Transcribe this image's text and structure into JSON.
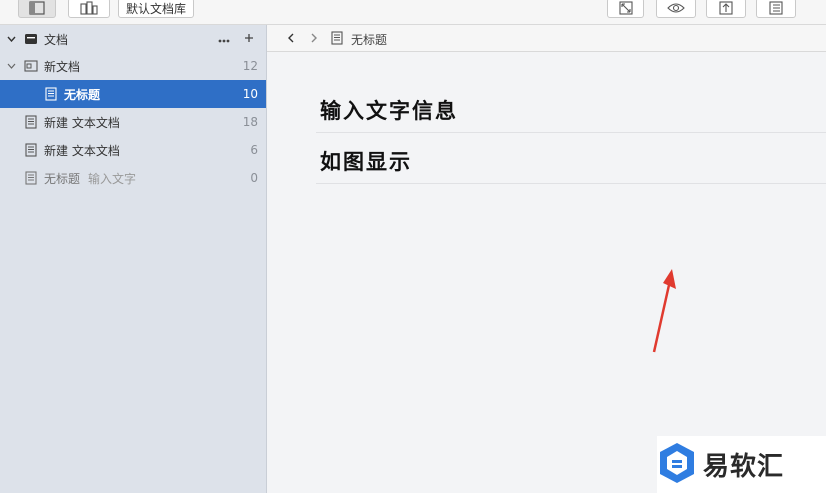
{
  "toolbar": {
    "library_label": "默认文档库"
  },
  "sidebar": {
    "root": {
      "label": "文档"
    },
    "items": [
      {
        "label": "新文档",
        "count": "12"
      },
      {
        "label": "无标题",
        "count": "10"
      },
      {
        "label": "新建 文本文档",
        "count": "18"
      },
      {
        "label": "新建 文本文档",
        "count": "6"
      },
      {
        "label": "无标题",
        "subtitle": "输入文字",
        "count": "0"
      }
    ]
  },
  "main": {
    "nav_title": "无标题",
    "lines": [
      "输入文字信息",
      "如图显示"
    ]
  },
  "watermark": {
    "text": "易软汇"
  },
  "colors": {
    "selection": "#2f6fc6",
    "sidebar_bg": "#dde2ea",
    "arrow": "#e03a2f",
    "logo_blue": "#2f7de1"
  }
}
